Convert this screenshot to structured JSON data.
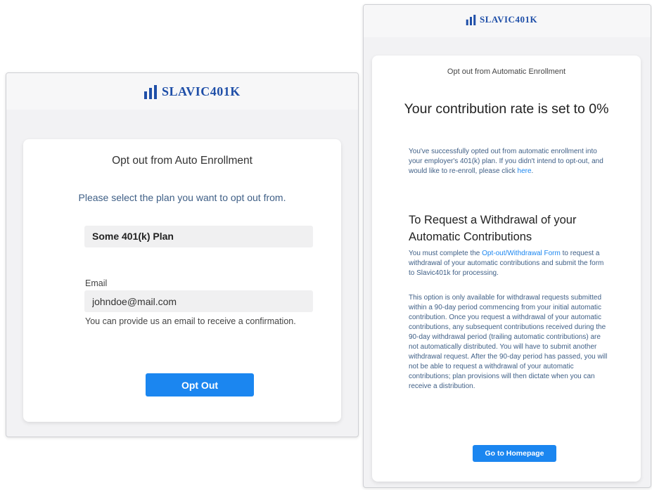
{
  "brand": {
    "logo_text": "SLAVIC401K",
    "color": "#1f4fa8"
  },
  "accent_color": "#1b86f0",
  "left_window": {
    "title": "Opt out from Auto Enrollment",
    "instruction": "Please select the plan you want to opt out from.",
    "selected_plan": "Some 401(k) Plan",
    "email_label": "Email",
    "email_value": "johndoe@mail.com",
    "email_help": "You can provide us an email to receive a confirmation.",
    "opt_out_button": "Opt Out"
  },
  "right_window": {
    "title": "Opt out from Automatic Enrollment",
    "heading": "Your contribution rate is set to 0%",
    "confirmation_text": "You've successfully opted out from automatic enrollment into your employer's 401(k) plan. If you didn't intend to opt-out, and would like to re-enroll, please click",
    "reenroll_link": "here",
    "withdrawal_heading": "To Request a Withdrawal of your Automatic Contributions",
    "form_text_before": "You must complete the",
    "form_link": "Opt-out/Withdrawal Form",
    "form_text_after": "to request a withdrawal of your automatic contributions and submit the form to Slavic401k for processing.",
    "details_text": "This option is only available for withdrawal requests submitted within a 90-day period commencing from your initial automatic contribution. Once you request a withdrawal of your automatic contributions, any subsequent contributions received during the 90-day withdrawal period (trailing automatic contributions) are not automatically distributed. You will have to submit another withdrawal request. After the 90-day period has passed, you will not be able to request a withdrawal of your automatic contributions; plan provisions will then dictate when you can receive a distribution.",
    "homepage_button": "Go to Homepage"
  }
}
